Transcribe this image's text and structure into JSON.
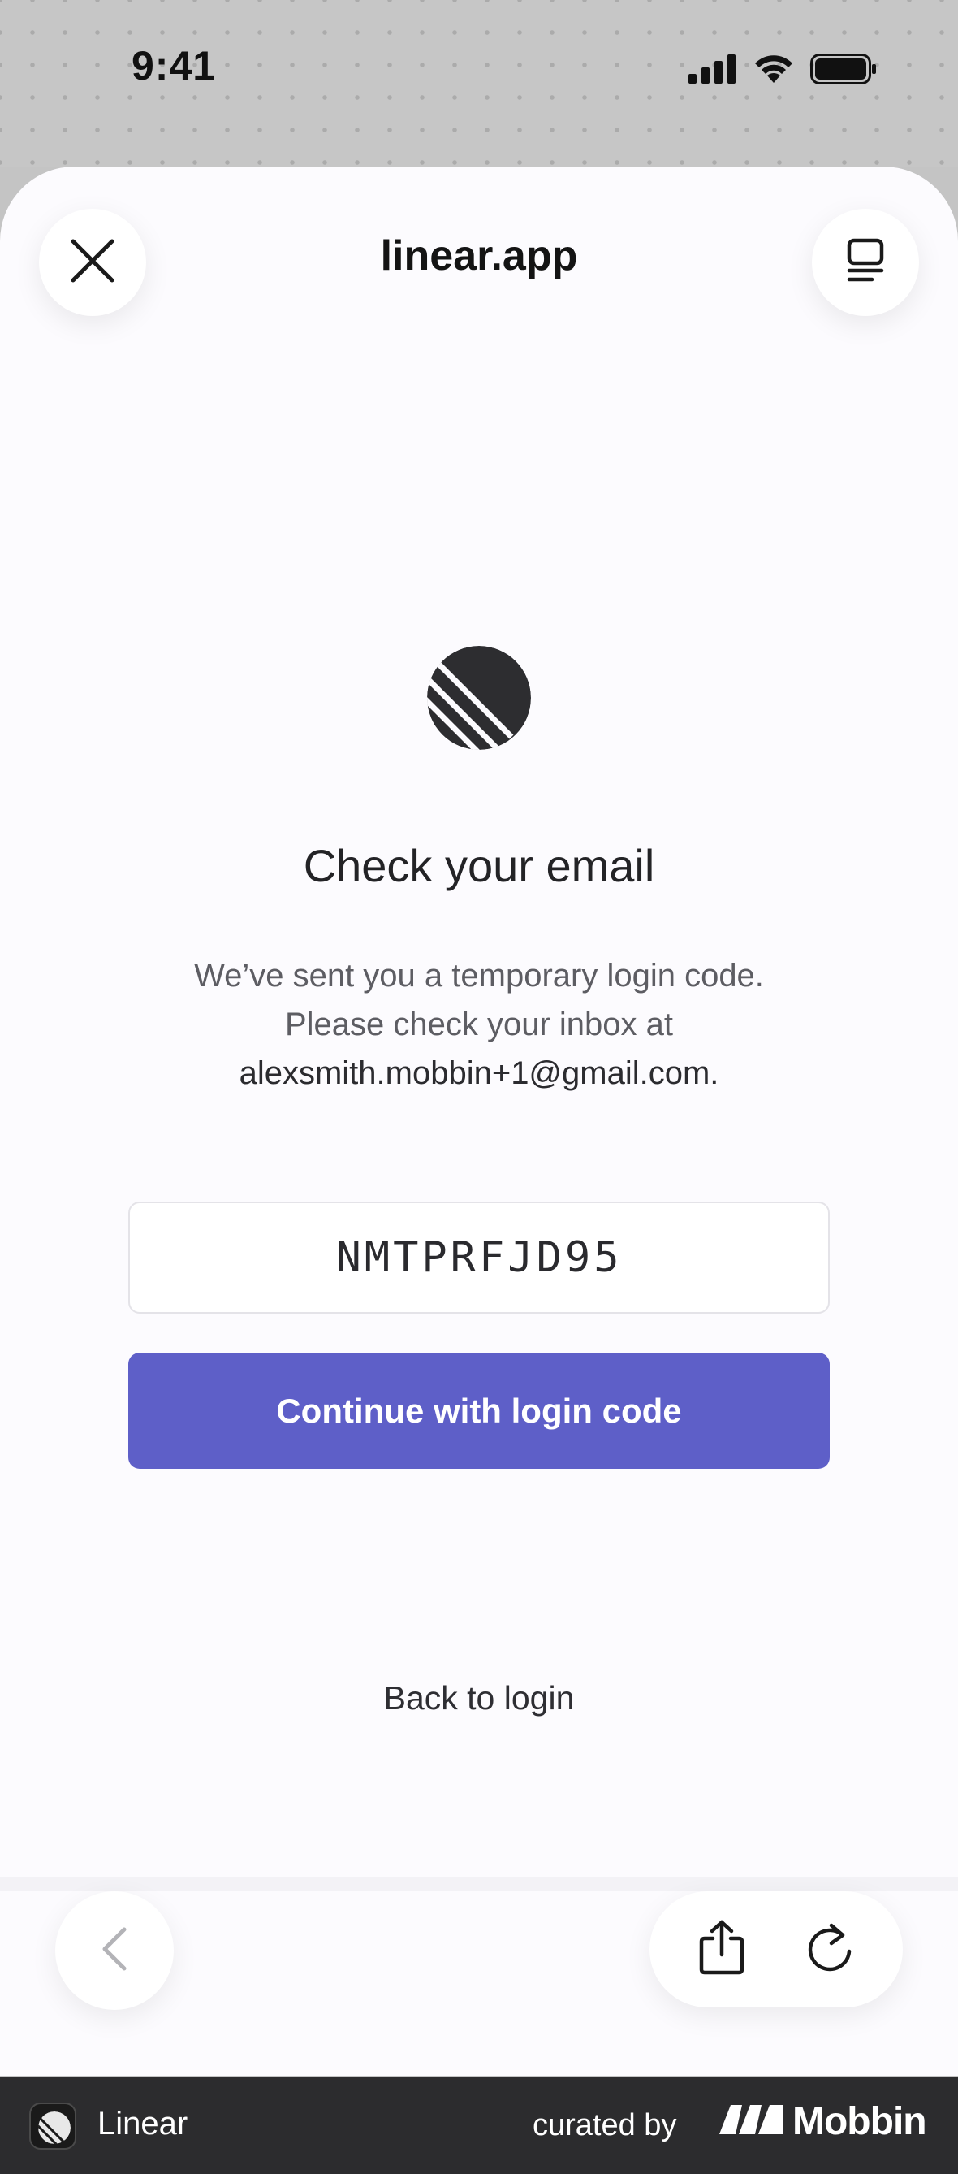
{
  "status_bar": {
    "time": "9:41",
    "icons": [
      "cellular-signal-icon",
      "wifi-icon",
      "battery-icon"
    ]
  },
  "browser": {
    "site_title": "linear.app",
    "close_icon": "close-icon",
    "tabs_icon": "tabs-icon"
  },
  "main": {
    "logo_icon": "linear-logo-icon",
    "heading": "Check your email",
    "description_line1": "We’ve sent you a temporary login code.",
    "description_line2": "Please check your inbox at",
    "email": "alexsmith.mobbin+1@gmail.com.",
    "code_value": "NMTPRFJD95",
    "continue_label": "Continue with login code",
    "back_label": "Back to login",
    "button_color": "#5e5fc8"
  },
  "toolbar": {
    "back_icon": "chevron-left-icon",
    "share_icon": "share-icon",
    "reload_icon": "reload-icon"
  },
  "footer": {
    "app_name": "Linear",
    "curated_label": "curated by",
    "brand_name": "Mobbin",
    "background": "#2c2c2e"
  }
}
